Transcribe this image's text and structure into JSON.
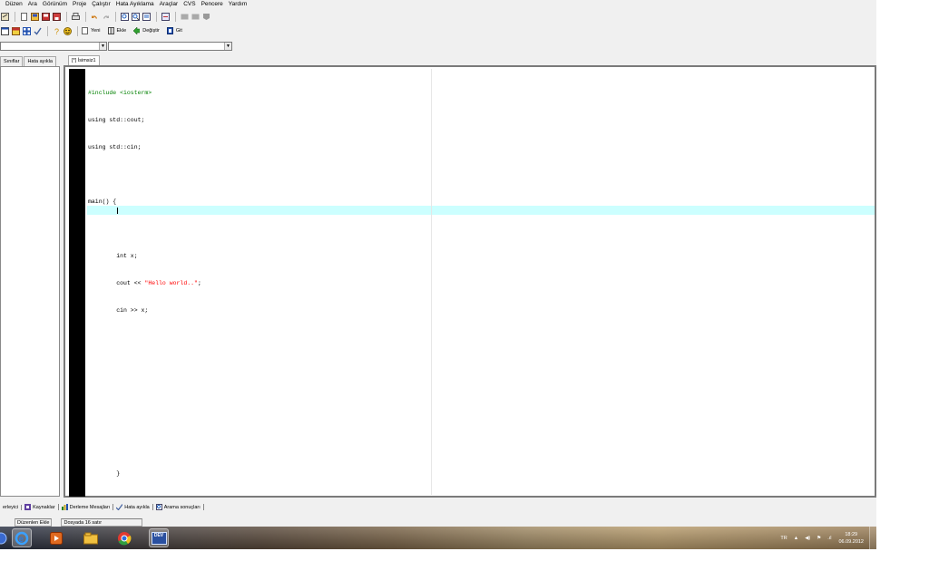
{
  "menu": [
    "Düzen",
    "Ara",
    "Görünüm",
    "Proje",
    "Çalıştır",
    "Hata Ayıklama",
    "Araçlar",
    "CVS",
    "Pencere",
    "Yardım"
  ],
  "toolbar2": {
    "new_label": "Yeni",
    "insert_label": "Ekle",
    "toggle_label": "Değiştir",
    "goto_label": "Git"
  },
  "left_tabs": [
    "Sınıflar",
    "Hata ayıkla"
  ],
  "editor": {
    "tab_label": "[*] İsimsiz1",
    "lines": [
      "#include <iosterm>",
      "using std::cout;",
      "using std::cin;",
      "",
      "main() {",
      "",
      "        int x;",
      "        cout << ",
      "\"Hello world..\"",
      ";",
      "        cin >> x;",
      "",
      "",
      "",
      "",
      "",
      "        }"
    ]
  },
  "bottom_tabs": [
    "erleyici",
    "Kaynaklar",
    "Derleme Mesajları",
    "Hata ayıkla",
    "Arama sonuçları"
  ],
  "status": {
    "mode": "Düzenlen",
    "insert": "Ekle",
    "lines": "Dosyada 16 satır"
  },
  "taskbar": {
    "lang": "TR",
    "time": "18:29",
    "date": "06.09.2012",
    "dev_label": "DEV"
  },
  "colors": {
    "active_line": "#ccffff",
    "directive": "#008000",
    "string": "#ff0000",
    "gutter": "#000000"
  }
}
